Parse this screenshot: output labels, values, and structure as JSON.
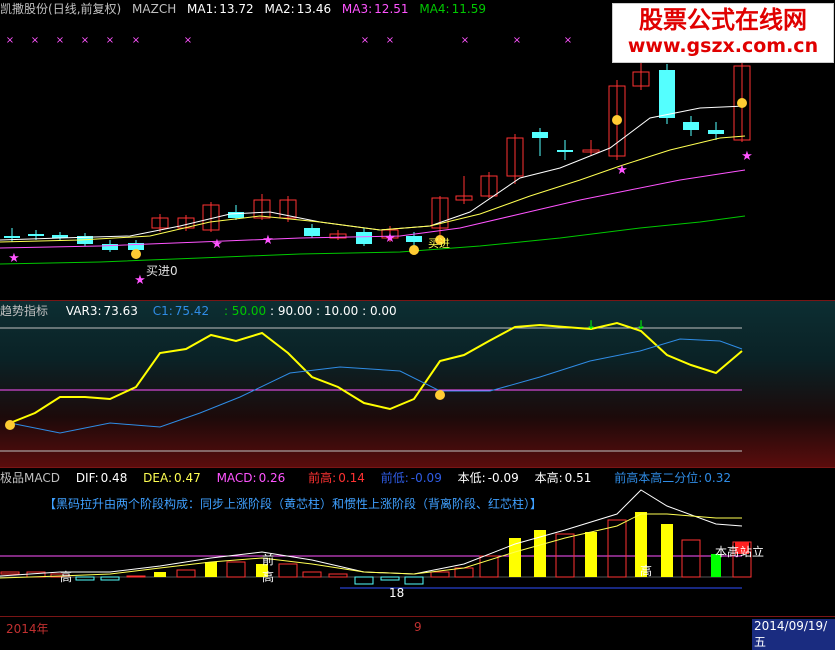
{
  "watermark": {
    "line1": "股票公式在线网",
    "line2": "www.gszx.com.cn"
  },
  "main": {
    "stock_name": "凯撒股份",
    "mode": "(日线,前复权)",
    "indicator": "MAZCH",
    "ma1_label": "MA1:",
    "ma1": "13.72",
    "ma2_label": "MA2:",
    "ma2": "13.46",
    "ma3_label": "MA3:",
    "ma3": "12.51",
    "ma4_label": "MA4:",
    "ma4": "11.59",
    "buy_label": "买进0",
    "buy_label2": "买进"
  },
  "trend": {
    "title": "趋势指标",
    "var3_label": "VAR3:",
    "var3": "73.63",
    "c1_label": "C1:",
    "c1": "75.42",
    "v50": ": 50.00",
    "v90": ": 90.00",
    "v10": ": 10.00",
    "v0": ": 0.00"
  },
  "macd": {
    "title": "极品MACD",
    "dif_label": "DIF:",
    "dif": "0.48",
    "dea_label": "DEA:",
    "dea": "0.47",
    "macd_label": "MACD:",
    "macd": "0.26",
    "qg_label": "前高:",
    "qg": "0.14",
    "qd_label": "前低:",
    "qd": "-0.09",
    "bd_label": "本低:",
    "bd": "-0.09",
    "bg_label": "本高:",
    "bg": "0.51",
    "q2_label": "前高本高二分位:",
    "q2": "0.32",
    "banner": "【黑码拉升由两个阶段构成：同步上涨阶段（黄芯柱）和惯性上涨阶段（背离阶段、红芯柱）】",
    "tag_gao": "高",
    "tag_qian": "前",
    "tag_benqu": "本高",
    "tag_zhan": "站立",
    "tag_18": "18"
  },
  "axis": {
    "year": "2014年",
    "tick": "9",
    "date": "2014/09/19/五"
  },
  "colors": {
    "up": "#ff3232",
    "down": "#54ffff",
    "ma1": "#ffffff",
    "ma2": "#ffff52",
    "ma3": "#ff54ff",
    "ma4": "#00c800",
    "var3": "#ffff00",
    "c1": "#2f8ce5"
  }
}
